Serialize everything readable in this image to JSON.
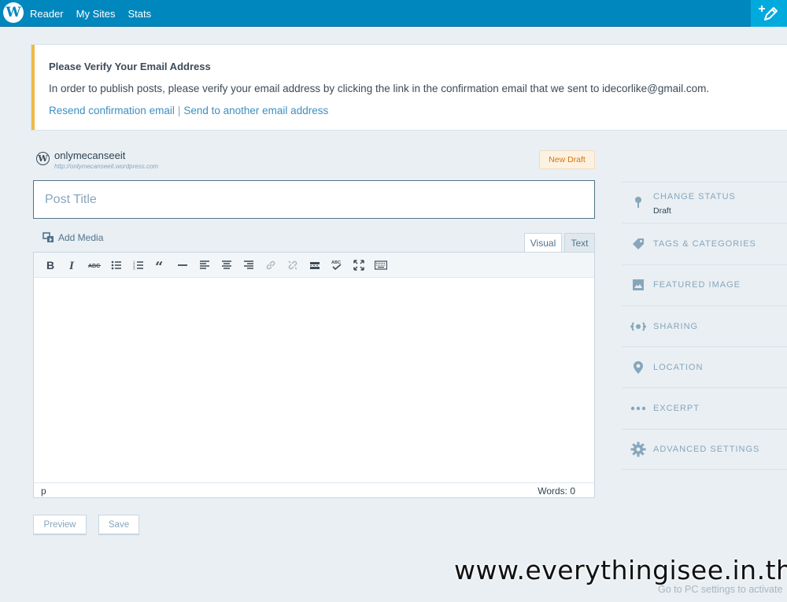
{
  "topbar": {
    "nav": [
      "Reader",
      "My Sites",
      "Stats"
    ]
  },
  "notice": {
    "title": "Please Verify Your Email Address",
    "text": "In order to publish posts, please verify your email address by clicking the link in the confirmation email that we sent to idecorlike@gmail.com.",
    "resend_link": "Resend confirmation email",
    "separator": "|",
    "another_link": "Send to another email address",
    "accent_color": "#f0b849"
  },
  "site": {
    "name": "onlymecanseeit",
    "url": "http://onlymecanseeit.wordpress.com",
    "status_badge": "New Draft"
  },
  "editor": {
    "title_placeholder": "Post Title",
    "add_media": "Add Media",
    "tabs": [
      "Visual",
      "Text"
    ],
    "toolbar_icons": [
      "bold-icon",
      "italic-icon",
      "strikethrough-icon",
      "bullet-list-icon",
      "numbered-list-icon",
      "blockquote-icon",
      "horizontal-rule-icon",
      "align-left-icon",
      "align-center-icon",
      "align-right-icon",
      "link-icon",
      "unlink-icon",
      "read-more-icon",
      "spellcheck-icon",
      "fullscreen-icon",
      "toolbar-toggle-icon"
    ],
    "path": "p",
    "word_count": "Words: 0"
  },
  "buttons": {
    "preview": "Preview",
    "save": "Save"
  },
  "sidebar": {
    "items": [
      {
        "label": "CHANGE STATUS",
        "sub": "Draft",
        "icon": "pin-icon"
      },
      {
        "label": "TAGS & CATEGORIES",
        "icon": "tag-icon"
      },
      {
        "label": "FEATURED IMAGE",
        "icon": "image-icon"
      },
      {
        "label": "SHARING",
        "icon": "sharing-icon"
      },
      {
        "label": "LOCATION",
        "icon": "location-icon"
      },
      {
        "label": "EXCERPT",
        "icon": "ellipsis-icon"
      },
      {
        "label": "ADVANCED SETTINGS",
        "icon": "gear-icon"
      }
    ]
  },
  "overlay": {
    "watermark": "www.everythingisee.in.th",
    "activate": "Go to PC settings to activate"
  },
  "colors": {
    "topbar": "#0087be",
    "write_button": "#00aadc",
    "background": "#e9eff3"
  }
}
